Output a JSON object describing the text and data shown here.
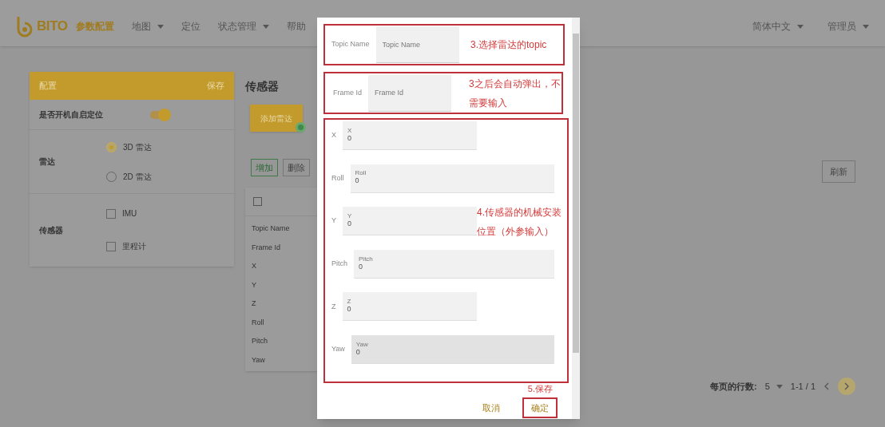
{
  "navbar": {
    "logo": "BITO",
    "items": [
      {
        "label": "参数配置",
        "selected": true,
        "dropdown": false
      },
      {
        "label": "地图",
        "selected": false,
        "dropdown": true
      },
      {
        "label": "定位",
        "selected": false,
        "dropdown": false
      },
      {
        "label": "状态管理",
        "selected": false,
        "dropdown": true
      },
      {
        "label": "帮助",
        "selected": false,
        "dropdown": false
      }
    ],
    "right": [
      {
        "label": "简体中文"
      },
      {
        "label": "管理员"
      }
    ]
  },
  "settings_panel": {
    "title": "配置",
    "action": "保存",
    "rows": [
      {
        "kind": "toggle",
        "label": "是否开机自启定位",
        "on": true
      },
      {
        "kind": "radio",
        "label": "雷达",
        "options": [
          {
            "label": "3D 雷达",
            "selected": true
          },
          {
            "label": "2D 雷达",
            "selected": false
          }
        ]
      },
      {
        "kind": "checkbox",
        "label": "传感器",
        "options": [
          {
            "label": "IMU",
            "checked": false
          },
          {
            "label": "里程计",
            "checked": false
          }
        ]
      }
    ]
  },
  "sensors": {
    "title": "传感器",
    "add_button": "添加雷达",
    "actions": [
      "增加",
      "删除"
    ],
    "refresh": "刷新",
    "table": {
      "header_checked": false,
      "rows": [
        "Topic Name",
        "Frame Id",
        "X",
        "Y",
        "Z",
        "Roll",
        "Pitch",
        "Yaw"
      ]
    },
    "pagination": {
      "rows_label": "每页的行数:",
      "rows_value": "5",
      "range": "1-1 / 1"
    }
  },
  "dialog": {
    "groups": [
      {
        "note": "3.选择雷达的topic",
        "fields": [
          {
            "kind": "plain",
            "label": "Topic Name",
            "placeholder": "Topic Name"
          }
        ]
      },
      {
        "note": "3之后会自动弹出，不需要输入",
        "fields": [
          {
            "kind": "plain",
            "label": "Frame Id",
            "placeholder": "Frame Id"
          }
        ]
      },
      {
        "note": "4.传感器的机械安装位置（外参输入）",
        "fields": [
          {
            "kind": "floating",
            "label": "X",
            "floating_label": "X",
            "value": "0",
            "focused": false
          },
          {
            "kind": "floating",
            "label": "Roll",
            "floating_label": "Roll",
            "value": "0",
            "focused": false
          },
          {
            "kind": "floating",
            "label": "Y",
            "floating_label": "Y",
            "value": "0",
            "focused": false
          },
          {
            "kind": "floating",
            "label": "Pitch",
            "floating_label": "Pitch",
            "value": "0",
            "focused": false
          },
          {
            "kind": "floating",
            "label": "Z",
            "floating_label": "Z",
            "value": "0",
            "focused": false
          },
          {
            "kind": "floating",
            "label": "Yaw",
            "floating_label": "Yaw",
            "value": "0",
            "focused": true
          }
        ]
      }
    ],
    "save_note": "5.保存",
    "buttons": [
      {
        "label": "取消",
        "annotated": false
      },
      {
        "label": "确定",
        "annotated": true
      }
    ]
  }
}
